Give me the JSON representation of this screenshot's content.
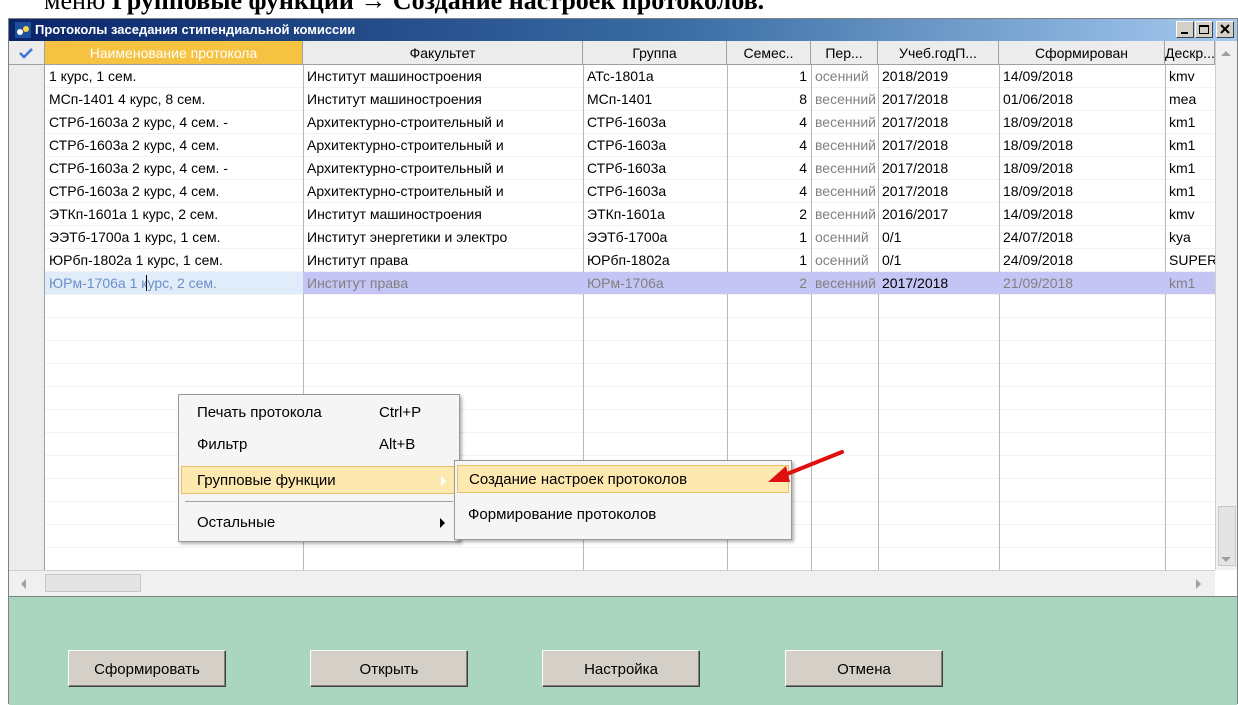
{
  "document": {
    "caption_prefix": "меню ",
    "caption_bold": "Групповые функции → Создание настроек протоколов."
  },
  "window": {
    "title": "Протоколы заседания стипендиальной комиссии"
  },
  "table": {
    "columns": [
      "Наименование протокола",
      "Факультет",
      "Группа",
      "Семес..",
      "Пер...",
      "Учеб.годП...",
      "Сформирован",
      "Дескр..."
    ],
    "rows": [
      {
        "name": "1 курс, 1 сем.",
        "faculty": "Институт машиностроения",
        "group": "АТс-1801а",
        "semester": "1",
        "period": "осенний",
        "year": "2018/2019",
        "formed": "14/09/2018",
        "descr": "kmv"
      },
      {
        "name": "МСп-1401 4 курс, 8 сем.",
        "faculty": "Институт машиностроения",
        "group": "МСп-1401",
        "semester": "8",
        "period": "весенний",
        "year": "2017/2018",
        "formed": "01/06/2018",
        "descr": "mea"
      },
      {
        "name": "СТРб-1603а 2 курс, 4 сем. -",
        "faculty": "Архитектурно-строительный и",
        "group": "СТРб-1603а",
        "semester": "4",
        "period": "весенний",
        "year": "2017/2018",
        "formed": "18/09/2018",
        "descr": "km1"
      },
      {
        "name": "СТРб-1603а 2 курс, 4 сем.",
        "faculty": "Архитектурно-строительный и",
        "group": "СТРб-1603а",
        "semester": "4",
        "period": "весенний",
        "year": "2017/2018",
        "formed": "18/09/2018",
        "descr": "km1"
      },
      {
        "name": "СТРб-1603а 2 курс, 4 сем. -",
        "faculty": "Архитектурно-строительный и",
        "group": "СТРб-1603а",
        "semester": "4",
        "period": "весенний",
        "year": "2017/2018",
        "formed": "18/09/2018",
        "descr": "km1"
      },
      {
        "name": "СТРб-1603а 2 курс, 4 сем.",
        "faculty": "Архитектурно-строительный и",
        "group": "СТРб-1603а",
        "semester": "4",
        "period": "весенний",
        "year": "2017/2018",
        "formed": "18/09/2018",
        "descr": "km1"
      },
      {
        "name": "ЭТКп-1601а 1 курс, 2 сем.",
        "faculty": "Институт машиностроения",
        "group": "ЭТКп-1601а",
        "semester": "2",
        "period": "весенний",
        "year": "2016/2017",
        "formed": "14/09/2018",
        "descr": "kmv"
      },
      {
        "name": "ЭЭТб-1700а 1 курс, 1 сем.",
        "faculty": "Институт энергетики и электро",
        "group": "ЭЭТб-1700а",
        "semester": "1",
        "period": "осенний",
        "year": "0/1",
        "formed": "24/07/2018",
        "descr": "kya"
      },
      {
        "name": "ЮРбп-1802а 1 курс, 1 сем.",
        "faculty": "Институт права",
        "group": "ЮРбп-1802а",
        "semester": "1",
        "period": "осенний",
        "year": "0/1",
        "formed": "24/09/2018",
        "descr": "SUPERV"
      },
      {
        "name": "ЮРм-1706а 1 курс, 2 сем.",
        "faculty": "Институт права",
        "group": "ЮРм-1706а",
        "semester": "2",
        "period": "весенний",
        "year": "2017/2018",
        "formed": "21/09/2018",
        "descr": "km1"
      }
    ]
  },
  "context_menu": {
    "items": [
      {
        "label": "Печать протокола",
        "shortcut": "Ctrl+P"
      },
      {
        "label": "Фильтр",
        "shortcut": "Alt+B"
      },
      {
        "label": "Групповые функции"
      },
      {
        "label": "Остальные"
      }
    ]
  },
  "submenu": {
    "items": [
      {
        "label": "Создание настроек протоколов"
      },
      {
        "label": "Формирование протоколов"
      }
    ]
  },
  "buttons": {
    "form": "Сформировать",
    "open": "Открыть",
    "settings": "Настройка",
    "cancel": "Отмена"
  },
  "colors": {
    "title_bar": "#0a246a",
    "header_selected": "#f5c242",
    "row_selected": "#c5c5f5",
    "panel": "#aad6c0",
    "menu_highlight": "#fde9b0",
    "pointer_arrow": "#e01010"
  }
}
